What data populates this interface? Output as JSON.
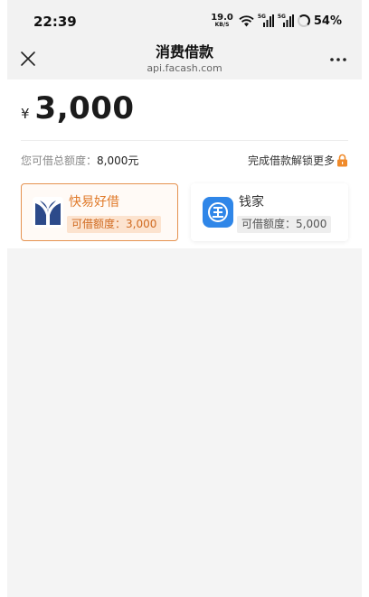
{
  "status_bar": {
    "time": "22:39",
    "net_speed": "19.0",
    "net_unit": "KB/S",
    "signal_1_tag": "5G",
    "signal_2_tag": "5G",
    "battery": "54%"
  },
  "nav": {
    "title": "消费借款",
    "url": "api.facash.com",
    "close_icon": "close-icon",
    "more_icon": "more-icon"
  },
  "loan": {
    "currency": "¥",
    "amount": "3,000",
    "limit_label": "您可借总额度：",
    "limit_value": "8,000元",
    "unlock_text": "完成借款解锁更多",
    "lock_color": "#f08a2a"
  },
  "lenders": [
    {
      "name": "快易好借",
      "limit": "可借额度：3,000",
      "selected": true,
      "logo_color": "#2c4a8a"
    },
    {
      "name": "钱家",
      "limit": "可借额度：5,000",
      "selected": false,
      "logo_color": "#2f86e8"
    }
  ],
  "colors": {
    "accent": "#e07a2a",
    "accent_border": "#e59250",
    "background": "#f4f4f4"
  }
}
